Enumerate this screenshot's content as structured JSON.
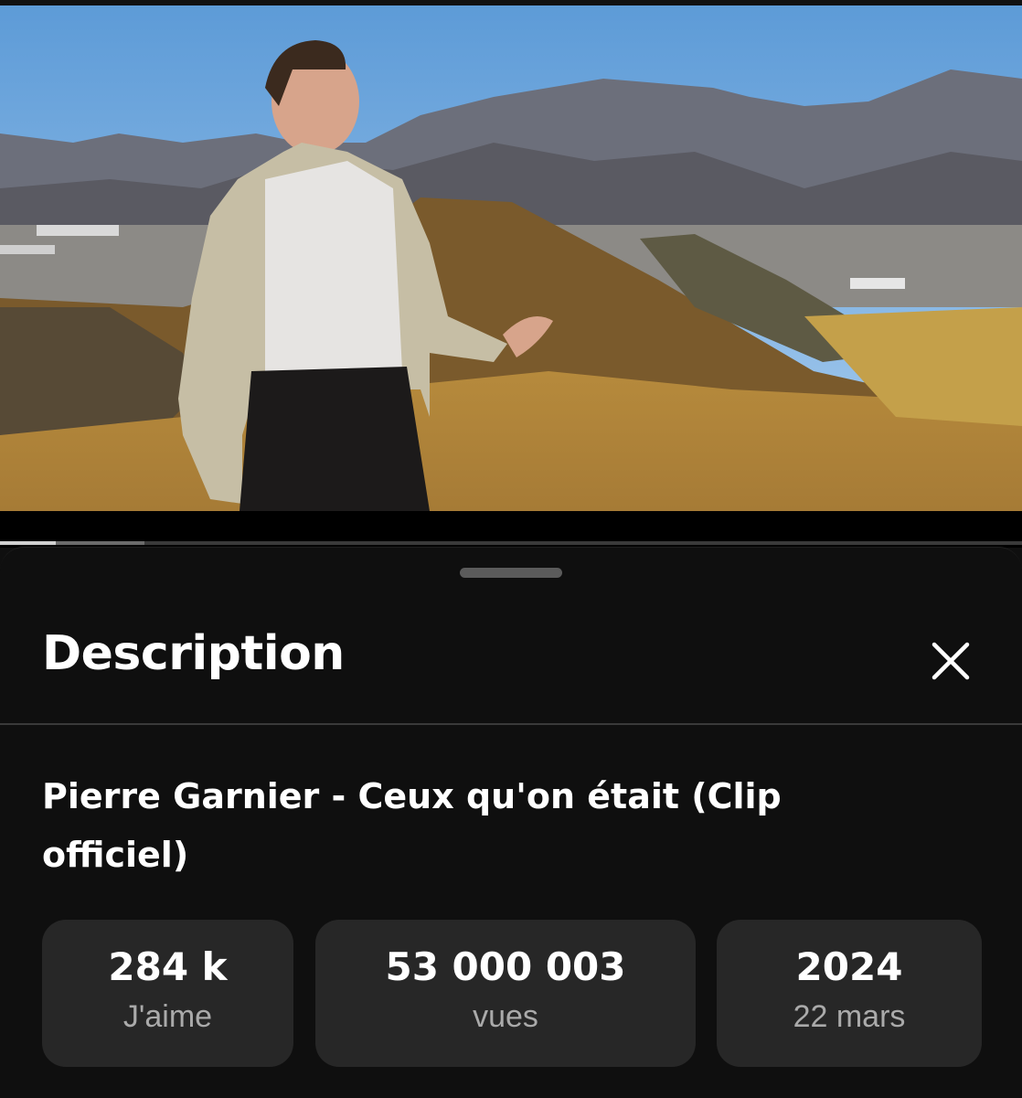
{
  "video": {
    "thumbnail_alt": "Pierre Garnier music video scene in a desert landscape",
    "progress_fraction": 0.055,
    "buffered_fraction": 0.142
  },
  "sheet": {
    "title": "Description",
    "close_icon": "close-icon"
  },
  "details": {
    "video_title": "Pierre Garnier - Ceux qu'on était (Clip officiel)",
    "stats": [
      {
        "value": "284 k",
        "label": "J'aime"
      },
      {
        "value": "53 000 003",
        "label": "vues"
      },
      {
        "value": "2024",
        "label": "22 mars"
      }
    ]
  },
  "colors": {
    "background": "#0f0f0f",
    "stat_card": "#272727",
    "muted_text": "#aaaaaa"
  }
}
